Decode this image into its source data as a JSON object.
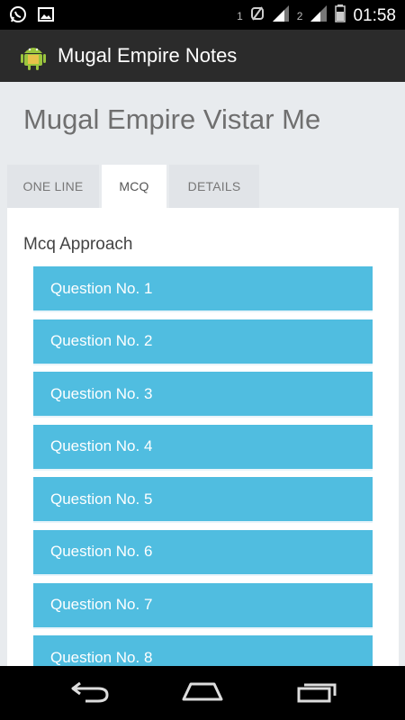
{
  "status_bar": {
    "time": "01:58",
    "sim1": "1",
    "sim2": "2",
    "icons": [
      "whatsapp-icon",
      "image-icon",
      "sim-signal-icon",
      "battery-icon"
    ]
  },
  "app_bar": {
    "title": "Mugal Empire Notes",
    "icon": "android-icon"
  },
  "page": {
    "title": "Mugal Empire Vistar Me"
  },
  "tabs": [
    {
      "label": "ONE LINE"
    },
    {
      "label": "MCQ"
    },
    {
      "label": "DETAILS"
    }
  ],
  "content": {
    "section_title": "Mcq Approach",
    "questions": [
      {
        "label": "Question No. 1"
      },
      {
        "label": "Question No. 2"
      },
      {
        "label": "Question No. 3"
      },
      {
        "label": "Question No. 4"
      },
      {
        "label": "Question No. 5"
      },
      {
        "label": "Question No. 6"
      },
      {
        "label": "Question No. 7"
      },
      {
        "label": "Question No. 8"
      }
    ]
  },
  "nav_bar": {
    "icons": [
      "back-icon",
      "home-icon",
      "recents-icon"
    ]
  },
  "colors": {
    "accent": "#50bde0",
    "appbar": "#2b2b2b",
    "background": "#e8ebee"
  }
}
